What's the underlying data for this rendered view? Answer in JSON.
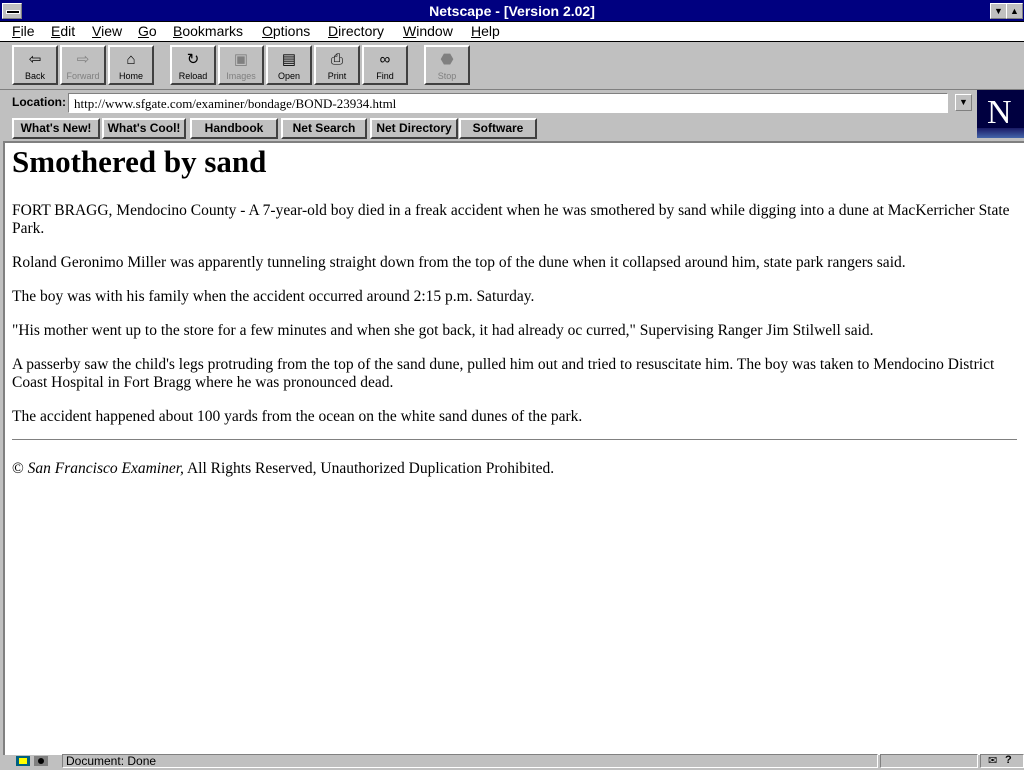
{
  "window": {
    "title": "Netscape - [Version 2.02]"
  },
  "menu": [
    "File",
    "Edit",
    "View",
    "Go",
    "Bookmarks",
    "Options",
    "Directory",
    "Window",
    "Help"
  ],
  "toolbar": {
    "back": "Back",
    "forward": "Forward",
    "home": "Home",
    "reload": "Reload",
    "images": "Images",
    "open": "Open",
    "print": "Print",
    "find": "Find",
    "stop": "Stop"
  },
  "location": {
    "label": "Location:",
    "url": "http://www.sfgate.com/examiner/bondage/BOND-23934.html"
  },
  "directory_buttons": [
    "What's New!",
    "What's Cool!",
    "Handbook",
    "Net Search",
    "Net Directory",
    "Software"
  ],
  "logo": {
    "letter": "N"
  },
  "article": {
    "headline": "Smothered by sand",
    "paragraphs": [
      "FORT BRAGG, Mendocino County - A 7-year-old boy died in a freak accident when he was smothered by sand while digging into a dune at MacKerricher State Park.",
      "Roland Geronimo Miller was apparently tunneling straight down from the top of the dune when it collapsed around him, state park rangers said.",
      "The boy was with his family when the accident occurred around 2:15 p.m. Saturday.",
      "\"His mother went up to the store for a few minutes and when she got back, it had already oc curred,\" Supervising Ranger Jim Stilwell said.",
      "A passerby saw the child's legs protruding from the top of the sand dune, pulled him out and tried to resuscitate him. The boy was taken to Mendocino District Coast Hospital in Fort Bragg where he was pronounced dead.",
      "The accident happened about 100 yards from the ocean on the white sand dunes of the park."
    ],
    "copyright_symbol": "©",
    "copyright_publication": "San Francisco Examiner,",
    "copyright_rest": "All Rights Reserved, Unauthorized Duplication Prohibited."
  },
  "status": {
    "message": "Document: Done"
  }
}
